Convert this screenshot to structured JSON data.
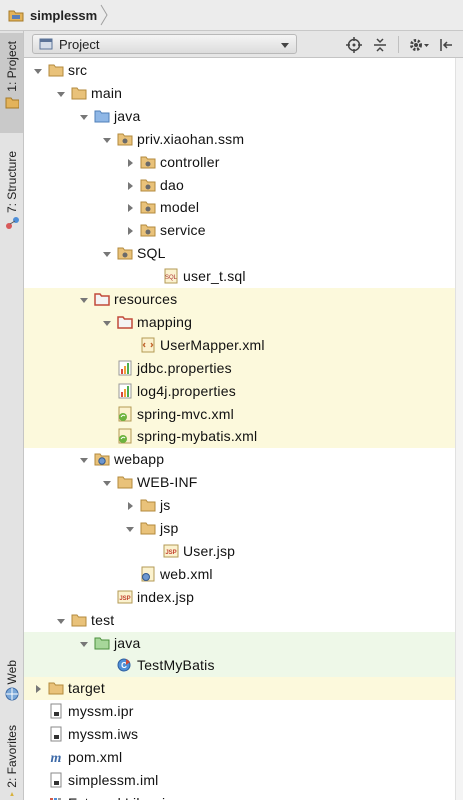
{
  "breadcrumb": {
    "project_name": "simplessm"
  },
  "side_tabs": {
    "project": "1: Project",
    "structure": "7: Structure",
    "web": "Web",
    "favorites": "2: Favorites"
  },
  "panel": {
    "view_selector": "Project"
  },
  "tree": [
    {
      "label": "src",
      "depth": 0,
      "arrow": "down",
      "icon": "folder",
      "bg": ""
    },
    {
      "label": "main",
      "depth": 1,
      "arrow": "down",
      "icon": "folder",
      "bg": ""
    },
    {
      "label": "java",
      "depth": 2,
      "arrow": "down",
      "icon": "folder-src",
      "bg": ""
    },
    {
      "label": "priv.xiaohan.ssm",
      "depth": 3,
      "arrow": "down",
      "icon": "package",
      "bg": ""
    },
    {
      "label": "controller",
      "depth": 4,
      "arrow": "right",
      "icon": "package",
      "bg": ""
    },
    {
      "label": "dao",
      "depth": 4,
      "arrow": "right",
      "icon": "package",
      "bg": ""
    },
    {
      "label": "model",
      "depth": 4,
      "arrow": "right",
      "icon": "package",
      "bg": ""
    },
    {
      "label": "service",
      "depth": 4,
      "arrow": "right",
      "icon": "package",
      "bg": ""
    },
    {
      "label": "SQL",
      "depth": 3,
      "arrow": "down",
      "icon": "package",
      "bg": ""
    },
    {
      "label": "user_t.sql",
      "depth": 5,
      "arrow": "",
      "icon": "sql",
      "bg": ""
    },
    {
      "label": "resources",
      "depth": 2,
      "arrow": "down",
      "icon": "folder-res",
      "bg": "y"
    },
    {
      "label": "mapping",
      "depth": 3,
      "arrow": "down",
      "icon": "folder-res",
      "bg": "y"
    },
    {
      "label": "UserMapper.xml",
      "depth": 4,
      "arrow": "",
      "icon": "xml",
      "bg": "y"
    },
    {
      "label": "jdbc.properties",
      "depth": 3,
      "arrow": "",
      "icon": "props",
      "bg": "y"
    },
    {
      "label": "log4j.properties",
      "depth": 3,
      "arrow": "",
      "icon": "props",
      "bg": "y"
    },
    {
      "label": "spring-mvc.xml",
      "depth": 3,
      "arrow": "",
      "icon": "spring",
      "bg": "y"
    },
    {
      "label": "spring-mybatis.xml",
      "depth": 3,
      "arrow": "",
      "icon": "spring",
      "bg": "y"
    },
    {
      "label": "webapp",
      "depth": 2,
      "arrow": "down",
      "icon": "folder-web",
      "bg": ""
    },
    {
      "label": "WEB-INF",
      "depth": 3,
      "arrow": "down",
      "icon": "folder",
      "bg": ""
    },
    {
      "label": "js",
      "depth": 4,
      "arrow": "right",
      "icon": "folder",
      "bg": ""
    },
    {
      "label": "jsp",
      "depth": 4,
      "arrow": "down",
      "icon": "folder",
      "bg": ""
    },
    {
      "label": "User.jsp",
      "depth": 5,
      "arrow": "",
      "icon": "jsp",
      "bg": ""
    },
    {
      "label": "web.xml",
      "depth": 4,
      "arrow": "",
      "icon": "webxml",
      "bg": ""
    },
    {
      "label": "index.jsp",
      "depth": 3,
      "arrow": "",
      "icon": "jsp",
      "bg": ""
    },
    {
      "label": "test",
      "depth": 1,
      "arrow": "down",
      "icon": "folder",
      "bg": ""
    },
    {
      "label": "java",
      "depth": 2,
      "arrow": "down",
      "icon": "folder-test",
      "bg": "g"
    },
    {
      "label": "TestMyBatis",
      "depth": 3,
      "arrow": "",
      "icon": "testclass",
      "bg": "g"
    },
    {
      "label": "target",
      "depth": 0,
      "arrow": "right",
      "icon": "folder-target",
      "bg": "y"
    },
    {
      "label": "myssm.ipr",
      "depth": 0,
      "arrow": "",
      "icon": "file",
      "bg": ""
    },
    {
      "label": "myssm.iws",
      "depth": 0,
      "arrow": "",
      "icon": "file",
      "bg": ""
    },
    {
      "label": "pom.xml",
      "depth": 0,
      "arrow": "",
      "icon": "maven",
      "bg": ""
    },
    {
      "label": "simplessm.iml",
      "depth": 0,
      "arrow": "",
      "icon": "file",
      "bg": ""
    },
    {
      "label": "External Libraries",
      "depth": -1,
      "arrow": "right",
      "icon": "libs",
      "bg": ""
    }
  ]
}
